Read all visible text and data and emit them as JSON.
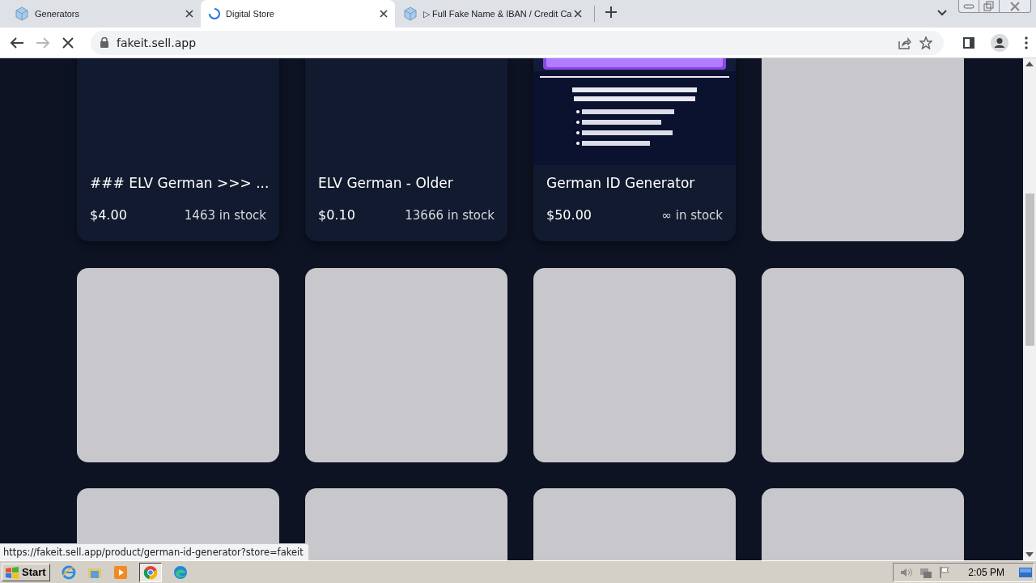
{
  "tabs": [
    {
      "title": "Generators",
      "selected": false,
      "loading": false
    },
    {
      "title": "Digital Store",
      "selected": true,
      "loading": true
    },
    {
      "title": "▷ Full Fake Name & IBAN / Credit Ca",
      "selected": false,
      "loading": false
    }
  ],
  "address_bar": {
    "url": "fakeit.sell.app"
  },
  "cards": [
    {
      "kind": "product",
      "has_image": false,
      "title": "### ELV German >>> ...",
      "price": "$4.00",
      "stock": "1463 in stock"
    },
    {
      "kind": "product",
      "has_image": false,
      "title": "ELV German - Older",
      "price": "$0.10",
      "stock": "13666 in stock"
    },
    {
      "kind": "product",
      "has_image": true,
      "title": "German ID Generator",
      "price": "$50.00",
      "stock": "∞ in stock"
    },
    {
      "kind": "placeholder"
    },
    {
      "kind": "placeholder"
    },
    {
      "kind": "placeholder"
    },
    {
      "kind": "placeholder"
    },
    {
      "kind": "placeholder"
    },
    {
      "kind": "placeholder"
    },
    {
      "kind": "placeholder"
    },
    {
      "kind": "placeholder"
    },
    {
      "kind": "placeholder"
    }
  ],
  "status_url": "https://fakeit.sell.app/product/german-id-generator?store=fakeit",
  "taskbar": {
    "start_label": "Start",
    "clock": "2:05 PM"
  }
}
